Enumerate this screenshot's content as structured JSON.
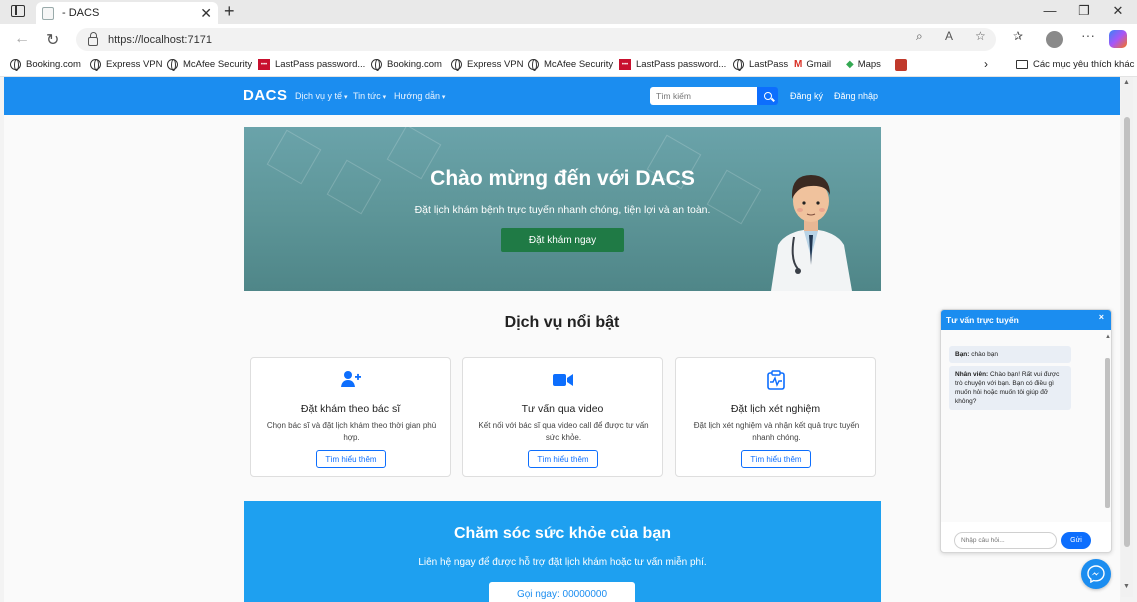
{
  "browser": {
    "tab_title": "- DACS",
    "url": "https://localhost:7171",
    "bookmarks": [
      {
        "label": "Booking.com",
        "icon": "globe-icon"
      },
      {
        "label": "Express VPN",
        "icon": "globe-icon"
      },
      {
        "label": "McAfee Security",
        "icon": "globe-icon"
      },
      {
        "label": "LastPass password...",
        "icon": "lastpass-icon"
      },
      {
        "label": "Booking.com",
        "icon": "globe-icon"
      },
      {
        "label": "Express VPN",
        "icon": "globe-icon"
      },
      {
        "label": "McAfee Security",
        "icon": "globe-icon"
      },
      {
        "label": "LastPass password...",
        "icon": "lastpass-icon"
      },
      {
        "label": "LastPass",
        "icon": "globe-icon"
      },
      {
        "label": "Gmail",
        "icon": "gmail-icon"
      },
      {
        "label": "Maps",
        "icon": "maps-icon"
      }
    ],
    "favorites_folder": "Các mục yêu thích khác"
  },
  "site": {
    "brand": "DACS",
    "menu": [
      "Dịch vụ y tế",
      "Tin tức",
      "Hướng dẫn"
    ],
    "search_placeholder": "Tìm kiếm",
    "register": "Đăng ký",
    "login": "Đăng nhập"
  },
  "hero": {
    "title": "Chào mừng đến với DACS",
    "subtitle": "Đặt lịch khám bệnh trực tuyến nhanh chóng, tiện lợi và an toàn.",
    "button": "Đặt khám ngay"
  },
  "services": {
    "title": "Dịch vụ nổi bật",
    "cards": [
      {
        "icon": "user-plus-icon",
        "title": "Đặt khám theo bác sĩ",
        "desc": "Chọn bác sĩ và đặt lịch khám theo thời gian phù hợp.",
        "button": "Tìm hiểu thêm"
      },
      {
        "icon": "video-camera-icon",
        "title": "Tư vấn qua video",
        "desc": "Kết nối với bác sĩ qua video call để được tư vấn sức khỏe.",
        "button": "Tìm hiểu thêm"
      },
      {
        "icon": "clipboard-pulse-icon",
        "title": "Đặt lịch xét nghiệm",
        "desc": "Đặt lịch xét nghiệm và nhận kết quả trực tuyến nhanh chóng.",
        "button": "Tìm hiểu thêm"
      }
    ]
  },
  "cta": {
    "title": "Chăm sóc sức khỏe của bạn",
    "subtitle": "Liên hệ ngay để được hỗ trợ đặt lịch khám hoặc tư vấn miễn phí.",
    "button": "Gọi ngay: 00000000"
  },
  "chat": {
    "title": "Tư vấn trực tuyến",
    "close": "×",
    "messages": [
      {
        "sender": "Bạn:",
        "text": "chào bạn"
      },
      {
        "sender": "Nhân viên:",
        "text": "Chào bạn! Rất vui được trò chuyện với bạn. Bạn có điều gì muốn hỏi hoặc muốn tôi giúp đỡ không?"
      }
    ],
    "input_placeholder": "Nhập câu hỏi...",
    "send": "Gửi"
  },
  "colors": {
    "primary": "#1b8df0",
    "button_blue": "#0d6efd",
    "hero_green_button": "#1f7a45",
    "cta_bg": "#1ea0f0"
  }
}
